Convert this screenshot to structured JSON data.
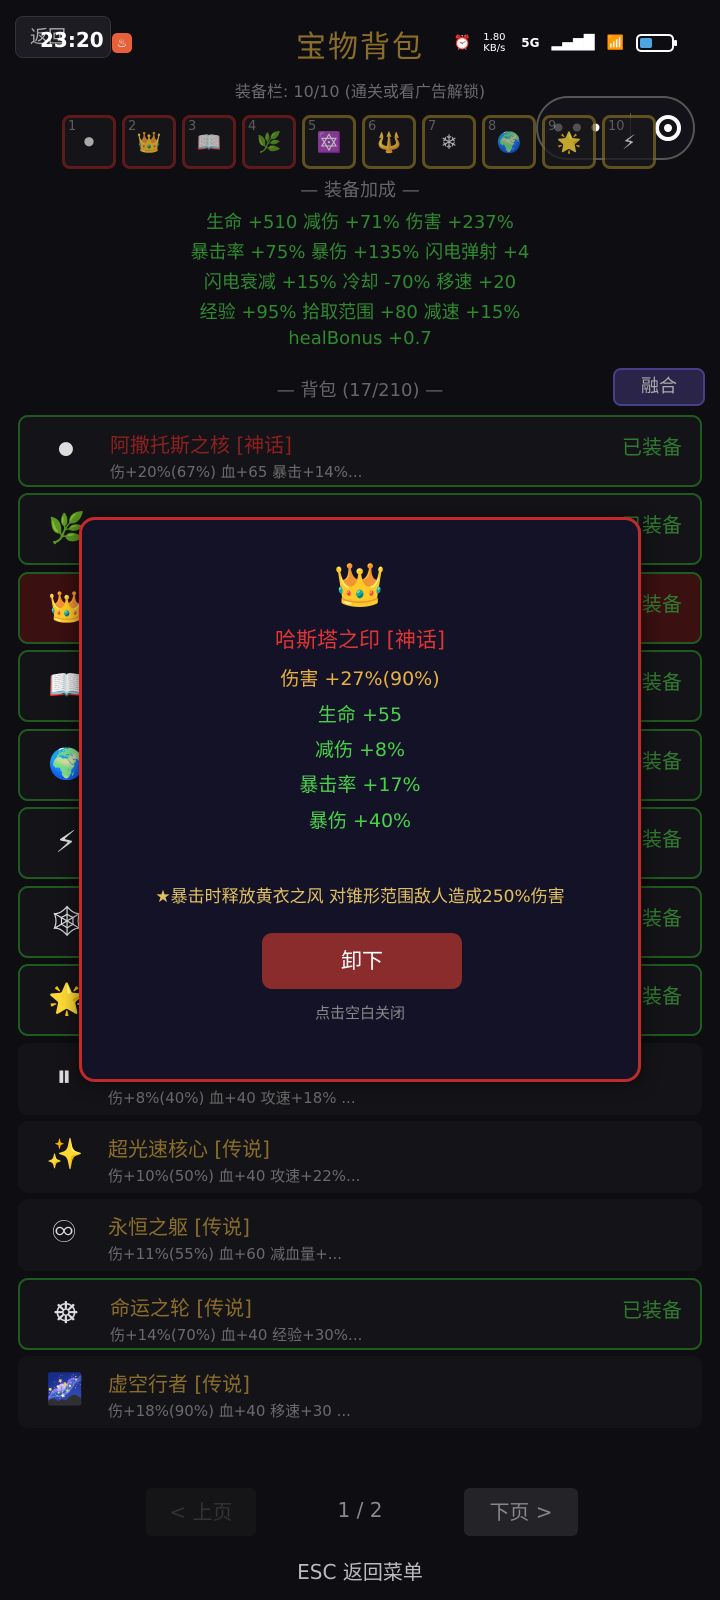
{
  "status": {
    "time": "23:20",
    "net_speed": "1.80 KB/s",
    "network": "5G",
    "back_label": "返回"
  },
  "title": "宝物背包",
  "slots_info": "装备栏: 10/10 (通关或看广告解锁)",
  "slots": [
    {
      "num": "1",
      "icon": "⚫",
      "border": "red"
    },
    {
      "num": "2",
      "icon": "👑",
      "border": "red"
    },
    {
      "num": "3",
      "icon": "📖",
      "border": "red"
    },
    {
      "num": "4",
      "icon": "🌿",
      "border": "red"
    },
    {
      "num": "5",
      "icon": "🔯",
      "border": "gold"
    },
    {
      "num": "6",
      "icon": "🔱",
      "border": "gold"
    },
    {
      "num": "7",
      "icon": "❄",
      "border": "gold"
    },
    {
      "num": "8",
      "icon": "🌍",
      "border": "gold"
    },
    {
      "num": "9",
      "icon": "🌟",
      "border": "gold"
    },
    {
      "num": "10",
      "icon": "⚡",
      "border": "gold"
    }
  ],
  "bonus": {
    "title": "— 装备加成 —",
    "lines": [
      "生命 +510  减伤 +71%  伤害 +237%",
      "暴击率 +75%  暴伤 +135%  闪电弹射 +4",
      "闪电衰减 +15%  冷却 -70%  移速 +20",
      "经验 +95%  拾取范围 +80  减速 +15%",
      "healBonus +0.7"
    ]
  },
  "bag": {
    "title": "— 背包 (17/210) —",
    "fuse_label": "融合"
  },
  "items": [
    {
      "icon": "⚫",
      "name": "阿撒托斯之核 [神话]",
      "stats": "伤+20%(67%) 血+65 暴击+14%...",
      "equipped": "已装备",
      "rarity": "myth",
      "style": "eq"
    },
    {
      "icon": "🌿",
      "name": "",
      "stats": "",
      "equipped": "已装备",
      "rarity": "myth",
      "style": "eq"
    },
    {
      "icon": "👑",
      "name": "",
      "stats": "",
      "equipped": "已装备",
      "rarity": "myth",
      "style": "red"
    },
    {
      "icon": "📖",
      "name": "",
      "stats": "",
      "equipped": "已装备",
      "rarity": "myth",
      "style": "eq"
    },
    {
      "icon": "🌍",
      "name": "",
      "stats": "",
      "equipped": "已装备",
      "rarity": "leg",
      "style": "eq"
    },
    {
      "icon": "⚡",
      "name": "",
      "stats": "",
      "equipped": "已装备",
      "rarity": "leg",
      "style": "eq"
    },
    {
      "icon": "🕸",
      "name": "",
      "stats": "",
      "equipped": "已装备",
      "rarity": "leg",
      "style": "eq"
    },
    {
      "icon": "🌟",
      "name": "",
      "stats": "",
      "equipped": "已装备",
      "rarity": "leg",
      "style": "eq"
    },
    {
      "icon": "⏸",
      "name": "时间停止 [传说]",
      "stats": "伤+8%(40%) 血+40 攻速+18% ...",
      "equipped": "",
      "rarity": "leg",
      "style": ""
    },
    {
      "icon": "✨",
      "name": "超光速核心 [传说]",
      "stats": "伤+10%(50%) 血+40 攻速+22%...",
      "equipped": "",
      "rarity": "leg",
      "style": ""
    },
    {
      "icon": "♾",
      "name": "永恒之躯 [传说]",
      "stats": "伤+11%(55%) 血+60 减血量+...",
      "equipped": "",
      "rarity": "leg",
      "style": ""
    },
    {
      "icon": "☸",
      "name": "命运之轮 [传说]",
      "stats": "伤+14%(70%) 血+40 经验+30%...",
      "equipped": "已装备",
      "rarity": "leg",
      "style": "eq"
    },
    {
      "icon": "🌌",
      "name": "虚空行者 [传说]",
      "stats": "伤+18%(90%) 血+40 移速+30 ...",
      "equipped": "",
      "rarity": "leg",
      "style": ""
    }
  ],
  "pager": {
    "prev": "< 上页",
    "page": "1 / 2",
    "next": "下页 >"
  },
  "esc": "ESC 返回菜单",
  "modal": {
    "icon": "👑",
    "name": "哈斯塔之印 [神话]",
    "stats": [
      {
        "text": "伤害 +27%(90%)",
        "color": "#e8b040"
      },
      {
        "text": "生命 +55",
        "color": "#4ad04a"
      },
      {
        "text": "减伤 +8%",
        "color": "#4ad04a"
      },
      {
        "text": "暴击率 +17%",
        "color": "#4ad04a"
      },
      {
        "text": "暴伤 +40%",
        "color": "#4ad04a"
      }
    ],
    "desc": "★暴击时释放黄衣之风 对锥形范围敌人造成250%伤害",
    "button": "卸下",
    "hint": "点击空白关闭"
  }
}
